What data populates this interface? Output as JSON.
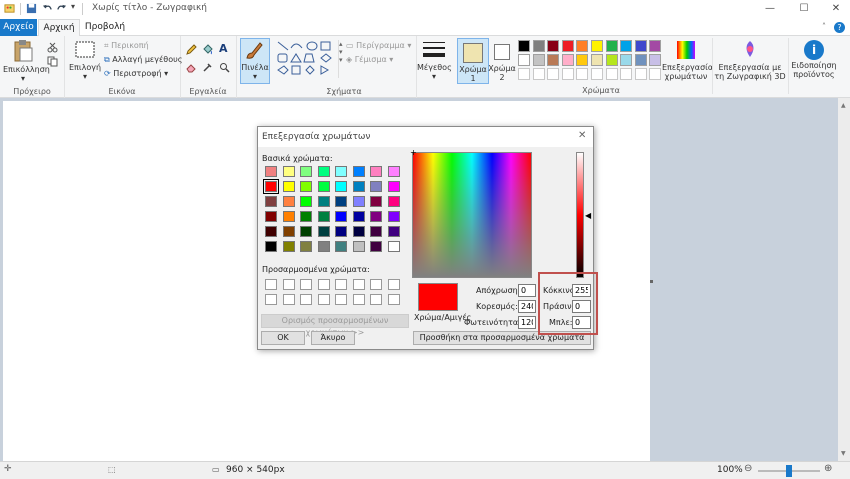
{
  "window": {
    "title": "Χωρίς τίτλο - Ζωγραφική",
    "minimize": "—",
    "maximize": "☐",
    "close": "✕",
    "help": "?"
  },
  "tabs": [
    {
      "label": "Αρχείο",
      "active_color": "#1979ca"
    },
    {
      "label": "Αρχική"
    },
    {
      "label": "Προβολή"
    }
  ],
  "ribbon": {
    "clipboard": {
      "paste": "Επικόλληση",
      "group": "Πρόχειρο"
    },
    "image": {
      "select": "Επιλογή",
      "crop": "Περικοπή",
      "resize": "Αλλαγή μεγέθους",
      "rotate": "Περιστροφή",
      "group": "Εικόνα"
    },
    "tools": {
      "group": "Εργαλεία"
    },
    "brushes": {
      "label": "Πινέλα"
    },
    "shapes": {
      "outline": "Περίγραμμα",
      "fill": "Γέμισμα",
      "group": "Σχήματα"
    },
    "size": {
      "label": "Μέγεθος"
    },
    "color1": {
      "label": "Χρώμα",
      "num": "1",
      "value": "#efe4b0"
    },
    "color2": {
      "label": "Χρώμα",
      "num": "2",
      "value": "#ffffff"
    },
    "colors": {
      "group": "Χρώματα",
      "row1": [
        "#000000",
        "#7f7f7f",
        "#880015",
        "#ed1c24",
        "#ff7f27",
        "#fff200",
        "#22b14c",
        "#00a2e8",
        "#3f48cc",
        "#a349a4"
      ],
      "row2": [
        "#ffffff",
        "#c3c3c3",
        "#b97a57",
        "#ffaec9",
        "#ffc90e",
        "#efe4b0",
        "#b5e61d",
        "#99d9ea",
        "#7092be",
        "#c8bfe7"
      ],
      "row3": [
        "#ffffff",
        "#ffffff",
        "#ffffff",
        "#ffffff",
        "#ffffff",
        "#ffffff",
        "#ffffff",
        "#ffffff",
        "#ffffff",
        "#ffffff"
      ]
    },
    "edit_colors": {
      "line1": "Επεξεργασία",
      "line2": "χρωμάτων"
    },
    "paint3d": {
      "line1": "Επεξεργασία με",
      "line2": "τη Ζωγραφική 3D"
    },
    "product_alert": {
      "line1": "Ειδοποίηση",
      "line2": "προϊόντος"
    }
  },
  "statusbar": {
    "dimensions": "960 × 540px",
    "zoom": "100%",
    "zoom_fraction": 0.5
  },
  "dialog": {
    "title": "Επεξεργασία χρωμάτων",
    "basic_colors_label": "Βασικά χρώματα:",
    "basic_colors": [
      [
        "#f08080",
        "#ffff80",
        "#80ff80",
        "#00ff80",
        "#80ffff",
        "#0080ff",
        "#ff80c0",
        "#ff80ff"
      ],
      [
        "#ff0000",
        "#ffff00",
        "#80ff00",
        "#00ff40",
        "#00ffff",
        "#0080c0",
        "#8080c0",
        "#ff00ff"
      ],
      [
        "#804040",
        "#ff8040",
        "#00ff00",
        "#008080",
        "#004080",
        "#8080ff",
        "#800040",
        "#ff0080"
      ],
      [
        "#800000",
        "#ff8000",
        "#008000",
        "#008040",
        "#0000ff",
        "#0000a0",
        "#800080",
        "#8000ff"
      ],
      [
        "#400000",
        "#804000",
        "#004000",
        "#004040",
        "#000080",
        "#000040",
        "#400040",
        "#400080"
      ],
      [
        "#000000",
        "#808000",
        "#808040",
        "#808080",
        "#408080",
        "#c0c0c0",
        "#400040",
        "#ffffff"
      ]
    ],
    "custom_colors_label": "Προσαρμοσμένα χρώματα:",
    "define_custom_button": "Ορισμός προσαρμοσμένων χρωμάτων >>",
    "ok_button": "OK",
    "cancel_button": "Άκυρο",
    "solid_color_label": "Χρώμα/Αμιγές",
    "current_color": "#ff0000",
    "hue_label": "Απόχρωση:",
    "hue": "0",
    "sat_label": "Κορεσμός:",
    "sat": "240",
    "lum_label": "Φωτεινότητα:",
    "lum": "120",
    "red_label": "Κόκκινο:",
    "red": "255",
    "green_label": "Πράσινο:",
    "green": "0",
    "blue_label": "Μπλε:",
    "blue": "0",
    "add_custom_button": "Προσθήκη στα προσαρμοσμένα χρώματα",
    "highlight_color": "#c0504d"
  }
}
